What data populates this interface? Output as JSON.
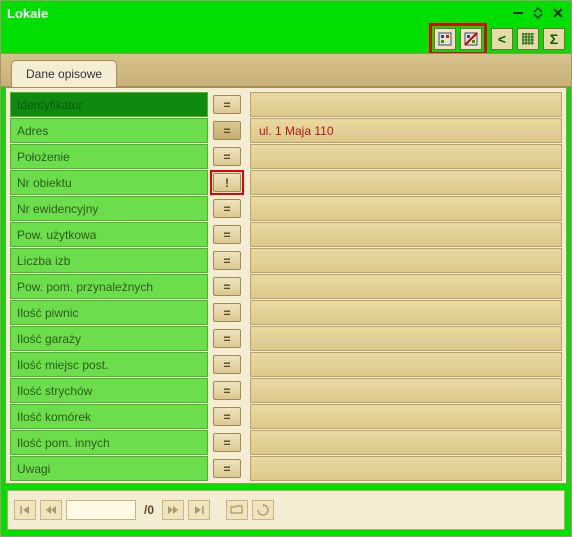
{
  "window": {
    "title": "Lokale"
  },
  "tab": {
    "label": "Dane opisowe"
  },
  "rows": [
    {
      "label": "Identyfikator",
      "op": "=",
      "value": "",
      "selected": true
    },
    {
      "label": "Adres",
      "op": "=",
      "value": "ul. 1 Maja 110",
      "darkop": true
    },
    {
      "label": "Położenie",
      "op": "=",
      "value": ""
    },
    {
      "label": "Nr obiektu",
      "op": "!",
      "value": "",
      "highlight": true
    },
    {
      "label": "Nr ewidencyjny",
      "op": "=",
      "value": ""
    },
    {
      "label": "Pow. użytkowa",
      "op": "=",
      "value": ""
    },
    {
      "label": "Liczba izb",
      "op": "=",
      "value": ""
    },
    {
      "label": "Pow. pom. przynależnych",
      "op": "=",
      "value": ""
    },
    {
      "label": "Ilość piwnic",
      "op": "=",
      "value": ""
    },
    {
      "label": "Ilość garaży",
      "op": "=",
      "value": ""
    },
    {
      "label": "Ilość miejsc post.",
      "op": "=",
      "value": ""
    },
    {
      "label": "Ilość strychów",
      "op": "=",
      "value": ""
    },
    {
      "label": "Ilość komórek",
      "op": "=",
      "value": ""
    },
    {
      "label": "Ilość pom. innych",
      "op": "=",
      "value": ""
    },
    {
      "label": "Uwagi",
      "op": "=",
      "value": ""
    }
  ],
  "nav": {
    "total": "/0"
  }
}
